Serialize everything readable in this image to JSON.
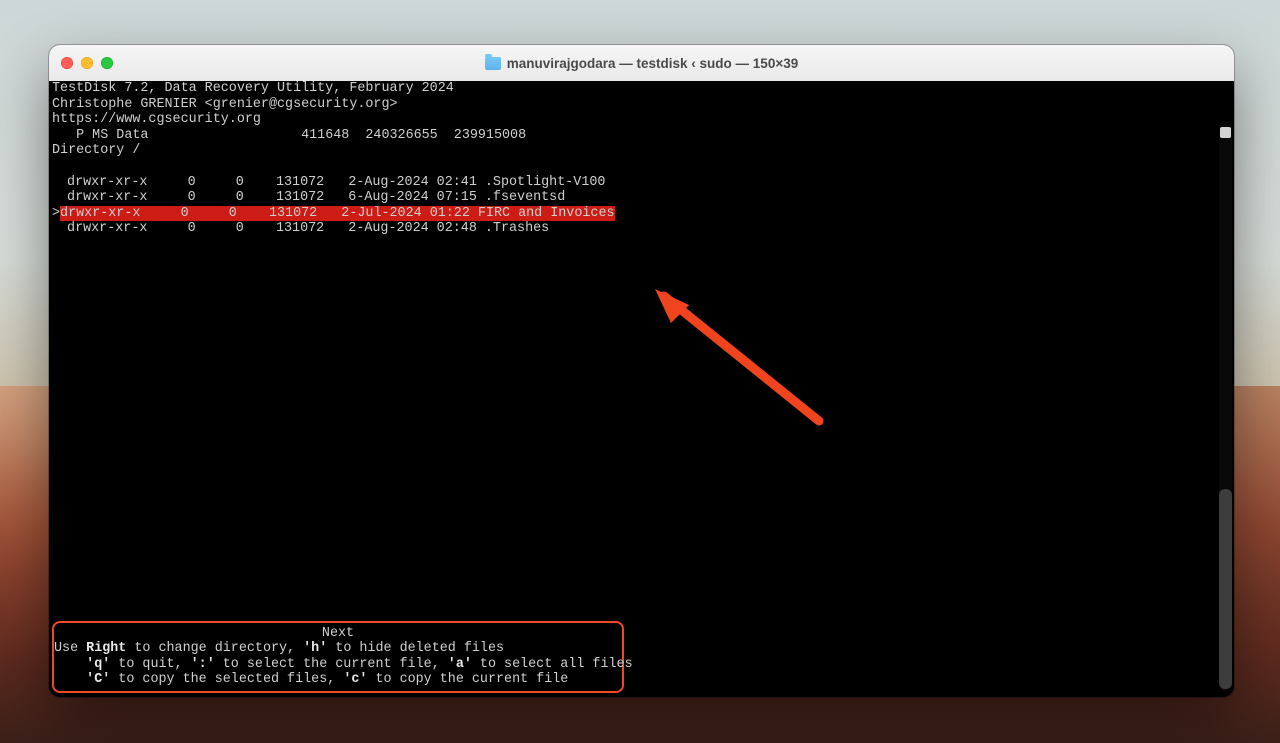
{
  "window": {
    "title": "manuvirajgodara — testdisk ‹ sudo — 150×39"
  },
  "header": {
    "line1": "TestDisk 7.2, Data Recovery Utility, February 2024",
    "line2": "Christophe GRENIER <grenier@cgsecurity.org>",
    "line3": "https://www.cgsecurity.org",
    "partition_line": "   P MS Data                   411648  240326655  239915008",
    "directory_line": "Directory /"
  },
  "listing": [
    {
      "perm": "drwxr-xr-x",
      "uid": "0",
      "gid": "0",
      "size": "131072",
      "date": "2-Aug-2024",
      "time": "02:41",
      "name": ".Spotlight-V100",
      "selected": false
    },
    {
      "perm": "drwxr-xr-x",
      "uid": "0",
      "gid": "0",
      "size": "131072",
      "date": "6-Aug-2024",
      "time": "07:15",
      "name": ".fseventsd",
      "selected": false
    },
    {
      "perm": "drwxr-xr-x",
      "uid": "0",
      "gid": "0",
      "size": "131072",
      "date": "2-Jul-2024",
      "time": "01:22",
      "name": "FIRC and Invoices",
      "selected": true
    },
    {
      "perm": "drwxr-xr-x",
      "uid": "0",
      "gid": "0",
      "size": "131072",
      "date": "2-Aug-2024",
      "time": "02:48",
      "name": ".Trashes",
      "selected": false
    }
  ],
  "footer": {
    "next": "Next",
    "line1_pre": "Use ",
    "right": "Right",
    "line1_mid": " to change directory, ",
    "h": "'h'",
    "line1_post": " to hide deleted files",
    "line2_pre": "    ",
    "q": "'q'",
    "line2_mid1": " to quit, ",
    "colon": "':'",
    "line2_mid2": " to select the current file, ",
    "a": "'a'",
    "line2_post": " to select all files",
    "line3_pre": "    ",
    "C": "'C'",
    "line3_mid": " to copy the selected files, ",
    "c": "'c'",
    "line3_post": " to copy the current file"
  },
  "annotation": {
    "arrow_color": "#f0441f"
  }
}
